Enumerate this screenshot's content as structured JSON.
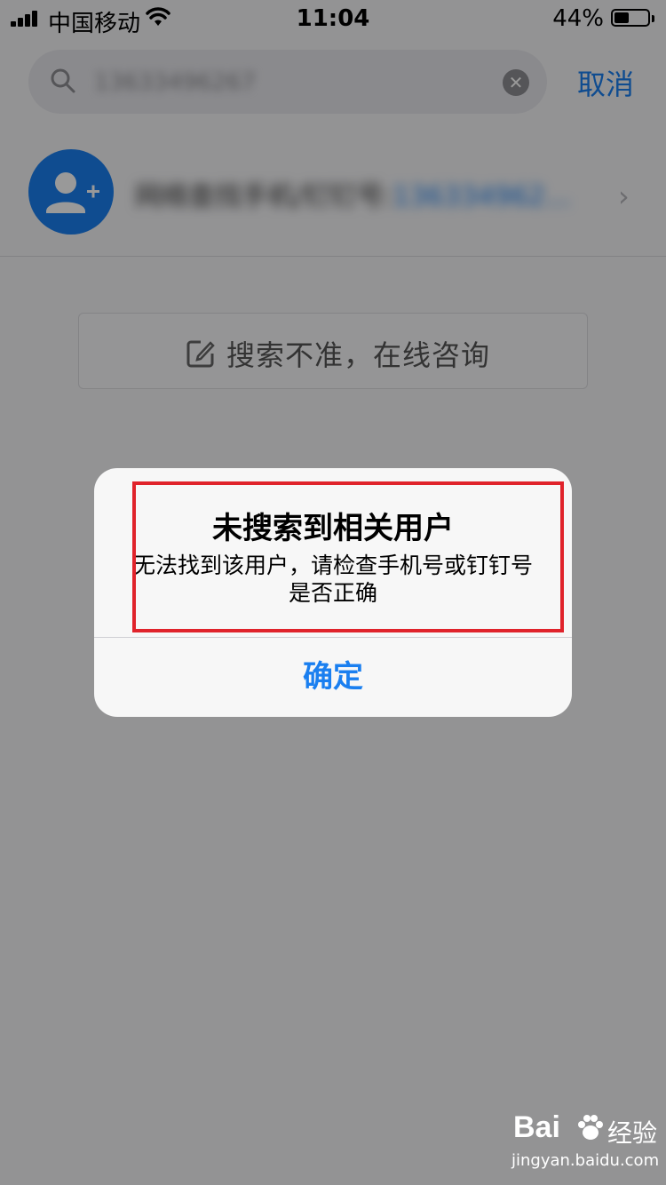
{
  "status_bar": {
    "carrier": "中国移动",
    "time": "11:04",
    "battery_percent": "44%",
    "battery_level": 0.44
  },
  "search": {
    "query": "13633496267",
    "cancel_label": "取消"
  },
  "result_row": {
    "label": "网络查找手机/钉钉号:",
    "number": "136334962..."
  },
  "consult": {
    "label": "搜索不准，在线咨询"
  },
  "alert": {
    "title": "未搜索到相关用户",
    "message": "无法找到该用户，请检查手机号或钉钉号是否正确",
    "confirm_label": "确定"
  },
  "watermark": {
    "logo": "Bai",
    "logo_suffix": "经验",
    "url": "jingyan.baidu.com"
  },
  "colors": {
    "accent": "#1a7ff0",
    "highlight": "#e0232b"
  }
}
